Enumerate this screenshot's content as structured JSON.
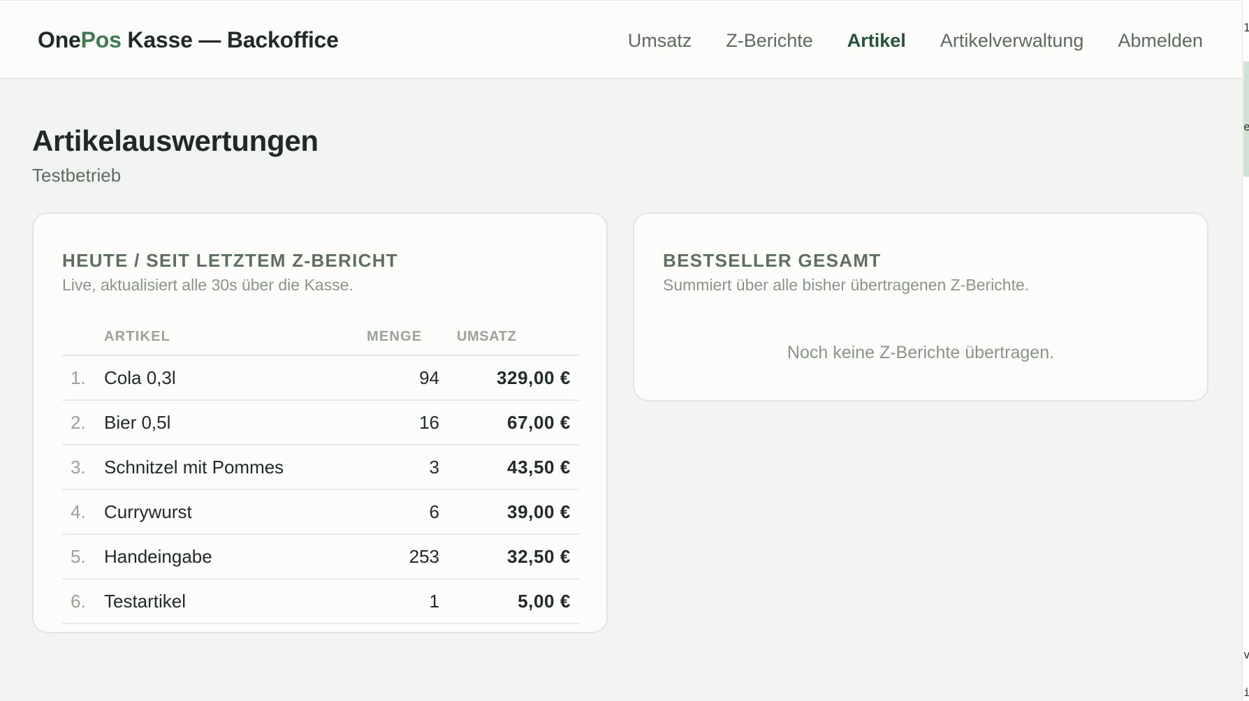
{
  "app": {
    "brand_prefix": "One",
    "brand_accent": "Pos",
    "brand_suffix": " Kasse — Backoffice",
    "colors": {
      "accent": "#3f7a52",
      "active_nav": "#24523a",
      "background": "#f2f4f2"
    }
  },
  "nav": {
    "items": [
      {
        "label": "Umsatz"
      },
      {
        "label": "Z-Berichte"
      },
      {
        "label": "Artikel",
        "active": true
      },
      {
        "label": "Artikelverwaltung"
      },
      {
        "label": "Abmelden"
      }
    ]
  },
  "page": {
    "title": "Artikelauswertungen",
    "subtitle": "Testbetrieb"
  },
  "today_card": {
    "title": "HEUTE / SEIT LETZTEM Z-BERICHT",
    "description": "Live, aktualisiert alle 30s über die Kasse.",
    "columns": {
      "article": "ARTIKEL",
      "quantity": "MENGE",
      "revenue": "UMSATZ"
    },
    "rows": [
      {
        "rank": "1.",
        "name": "Cola 0,3l",
        "quantity": "94",
        "revenue": "329,00 €"
      },
      {
        "rank": "2.",
        "name": "Bier 0,5l",
        "quantity": "16",
        "revenue": "67,00 €"
      },
      {
        "rank": "3.",
        "name": "Schnitzel mit Pommes",
        "quantity": "3",
        "revenue": "43,50 €"
      },
      {
        "rank": "4.",
        "name": "Currywurst",
        "quantity": "6",
        "revenue": "39,00 €"
      },
      {
        "rank": "5.",
        "name": "Handeingabe",
        "quantity": "253",
        "revenue": "32,50 €"
      },
      {
        "rank": "6.",
        "name": "Testartikel",
        "quantity": "1",
        "revenue": "5,00 €"
      }
    ]
  },
  "bestseller_card": {
    "title": "BESTSELLER GESAMT",
    "description": "Summiert über alle bisher übertragenen Z-Berichte.",
    "empty_message": "Noch keine Z-Berichte übertragen."
  },
  "side_strip": {
    "chars": [
      "1",
      "e",
      "v",
      "i"
    ]
  }
}
